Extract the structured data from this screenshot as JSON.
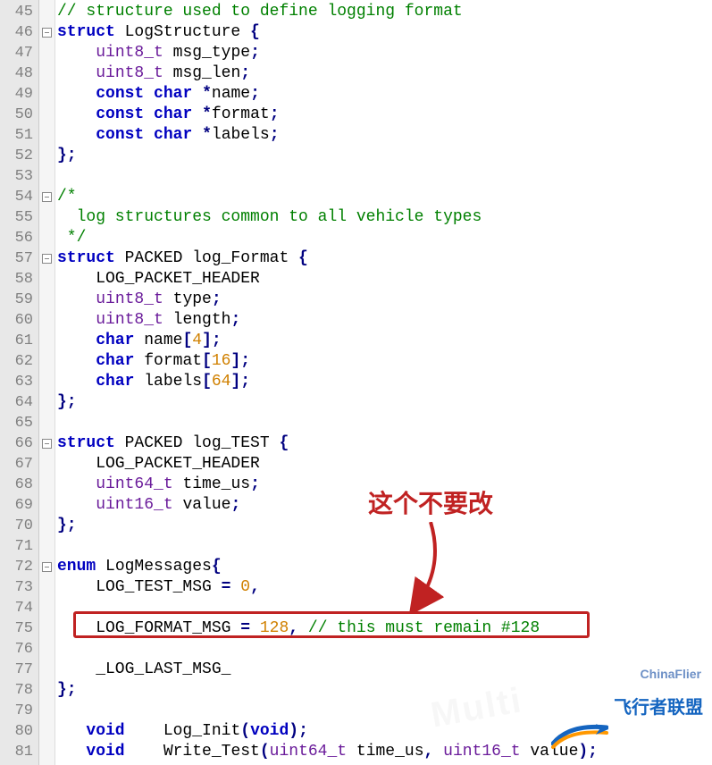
{
  "gutter_start": 45,
  "gutter_count": 37,
  "code_lines": [
    [
      [
        "tok-comm",
        "// structure used to define logging format"
      ]
    ],
    [
      [
        "tok-kw",
        "struct"
      ],
      [
        "tok-id",
        " LogStructure "
      ],
      [
        "tok-op",
        "{"
      ]
    ],
    [
      [
        "tok-id",
        "    "
      ],
      [
        "tok-type",
        "uint8_t"
      ],
      [
        "tok-id",
        " msg_type"
      ],
      [
        "tok-op",
        ";"
      ]
    ],
    [
      [
        "tok-id",
        "    "
      ],
      [
        "tok-type",
        "uint8_t"
      ],
      [
        "tok-id",
        " msg_len"
      ],
      [
        "tok-op",
        ";"
      ]
    ],
    [
      [
        "tok-id",
        "    "
      ],
      [
        "tok-kw",
        "const"
      ],
      [
        "tok-id",
        " "
      ],
      [
        "tok-kw",
        "char"
      ],
      [
        "tok-id",
        " "
      ],
      [
        "tok-op",
        "*"
      ],
      [
        "tok-id",
        "name"
      ],
      [
        "tok-op",
        ";"
      ]
    ],
    [
      [
        "tok-id",
        "    "
      ],
      [
        "tok-kw",
        "const"
      ],
      [
        "tok-id",
        " "
      ],
      [
        "tok-kw",
        "char"
      ],
      [
        "tok-id",
        " "
      ],
      [
        "tok-op",
        "*"
      ],
      [
        "tok-id",
        "format"
      ],
      [
        "tok-op",
        ";"
      ]
    ],
    [
      [
        "tok-id",
        "    "
      ],
      [
        "tok-kw",
        "const"
      ],
      [
        "tok-id",
        " "
      ],
      [
        "tok-kw",
        "char"
      ],
      [
        "tok-id",
        " "
      ],
      [
        "tok-op",
        "*"
      ],
      [
        "tok-id",
        "labels"
      ],
      [
        "tok-op",
        ";"
      ]
    ],
    [
      [
        "tok-op",
        "};"
      ]
    ],
    [
      [
        "",
        ""
      ]
    ],
    [
      [
        "tok-comm",
        "/*"
      ]
    ],
    [
      [
        "tok-comm",
        "  log structures common to all vehicle types"
      ]
    ],
    [
      [
        "tok-comm",
        " */"
      ]
    ],
    [
      [
        "tok-kw",
        "struct"
      ],
      [
        "tok-id",
        " PACKED log_Format "
      ],
      [
        "tok-op",
        "{"
      ]
    ],
    [
      [
        "tok-id",
        "    LOG_PACKET_HEADER"
      ]
    ],
    [
      [
        "tok-id",
        "    "
      ],
      [
        "tok-type",
        "uint8_t"
      ],
      [
        "tok-id",
        " type"
      ],
      [
        "tok-op",
        ";"
      ]
    ],
    [
      [
        "tok-id",
        "    "
      ],
      [
        "tok-type",
        "uint8_t"
      ],
      [
        "tok-id",
        " length"
      ],
      [
        "tok-op",
        ";"
      ]
    ],
    [
      [
        "tok-id",
        "    "
      ],
      [
        "tok-kw",
        "char"
      ],
      [
        "tok-id",
        " name"
      ],
      [
        "tok-op",
        "["
      ],
      [
        "tok-num",
        "4"
      ],
      [
        "tok-op",
        "];"
      ]
    ],
    [
      [
        "tok-id",
        "    "
      ],
      [
        "tok-kw",
        "char"
      ],
      [
        "tok-id",
        " format"
      ],
      [
        "tok-op",
        "["
      ],
      [
        "tok-num",
        "16"
      ],
      [
        "tok-op",
        "];"
      ]
    ],
    [
      [
        "tok-id",
        "    "
      ],
      [
        "tok-kw",
        "char"
      ],
      [
        "tok-id",
        " labels"
      ],
      [
        "tok-op",
        "["
      ],
      [
        "tok-num",
        "64"
      ],
      [
        "tok-op",
        "];"
      ]
    ],
    [
      [
        "tok-op",
        "};"
      ]
    ],
    [
      [
        "",
        ""
      ]
    ],
    [
      [
        "tok-kw",
        "struct"
      ],
      [
        "tok-id",
        " PACKED log_TEST "
      ],
      [
        "tok-op",
        "{"
      ]
    ],
    [
      [
        "tok-id",
        "    LOG_PACKET_HEADER"
      ]
    ],
    [
      [
        "tok-id",
        "    "
      ],
      [
        "tok-type",
        "uint64_t"
      ],
      [
        "tok-id",
        " time_us"
      ],
      [
        "tok-op",
        ";"
      ]
    ],
    [
      [
        "tok-id",
        "    "
      ],
      [
        "tok-type",
        "uint16_t"
      ],
      [
        "tok-id",
        " value"
      ],
      [
        "tok-op",
        ";"
      ]
    ],
    [
      [
        "tok-op",
        "};"
      ]
    ],
    [
      [
        "",
        ""
      ]
    ],
    [
      [
        "tok-kw",
        "enum"
      ],
      [
        "tok-id",
        " LogMessages"
      ],
      [
        "tok-op",
        "{"
      ]
    ],
    [
      [
        "tok-id",
        "    LOG_TEST_MSG "
      ],
      [
        "tok-op",
        "="
      ],
      [
        "tok-id",
        " "
      ],
      [
        "tok-num",
        "0"
      ],
      [
        "tok-op",
        ","
      ]
    ],
    [
      [
        "",
        ""
      ]
    ],
    [
      [
        "tok-id",
        "    LOG_FORMAT_MSG "
      ],
      [
        "tok-op",
        "="
      ],
      [
        "tok-id",
        " "
      ],
      [
        "tok-num",
        "128"
      ],
      [
        "tok-op",
        ","
      ],
      [
        "tok-id",
        " "
      ],
      [
        "tok-comm",
        "// this must remain #128"
      ]
    ],
    [
      [
        "",
        ""
      ]
    ],
    [
      [
        "tok-id",
        "    _LOG_LAST_MSG_"
      ]
    ],
    [
      [
        "tok-op",
        "};"
      ]
    ],
    [
      [
        "",
        ""
      ]
    ],
    [
      [
        "tok-id",
        "   "
      ],
      [
        "tok-kw",
        "void"
      ],
      [
        "tok-id",
        "    Log_Init"
      ],
      [
        "tok-op",
        "("
      ],
      [
        "tok-kw",
        "void"
      ],
      [
        "tok-op",
        ");"
      ]
    ],
    [
      [
        "tok-id",
        "   "
      ],
      [
        "tok-kw",
        "void"
      ],
      [
        "tok-id",
        "    Write_Test"
      ],
      [
        "tok-op",
        "("
      ],
      [
        "tok-type",
        "uint64_t"
      ],
      [
        "tok-id",
        " time_us"
      ],
      [
        "tok-op",
        ","
      ],
      [
        "tok-id",
        " "
      ],
      [
        "tok-type",
        "uint16_t"
      ],
      [
        "tok-id",
        " value"
      ],
      [
        "tok-op",
        ");"
      ]
    ]
  ],
  "fold_rows": [
    46,
    52,
    54,
    57,
    64,
    66,
    70,
    72,
    78
  ],
  "fold_close_rows": [
    52,
    64,
    70,
    78
  ],
  "callout": {
    "text": "这个不要改"
  },
  "logo": {
    "brand_en": "飞行者联盟",
    "brand_cn": "ChinaFlier"
  },
  "watermark": "Multi"
}
